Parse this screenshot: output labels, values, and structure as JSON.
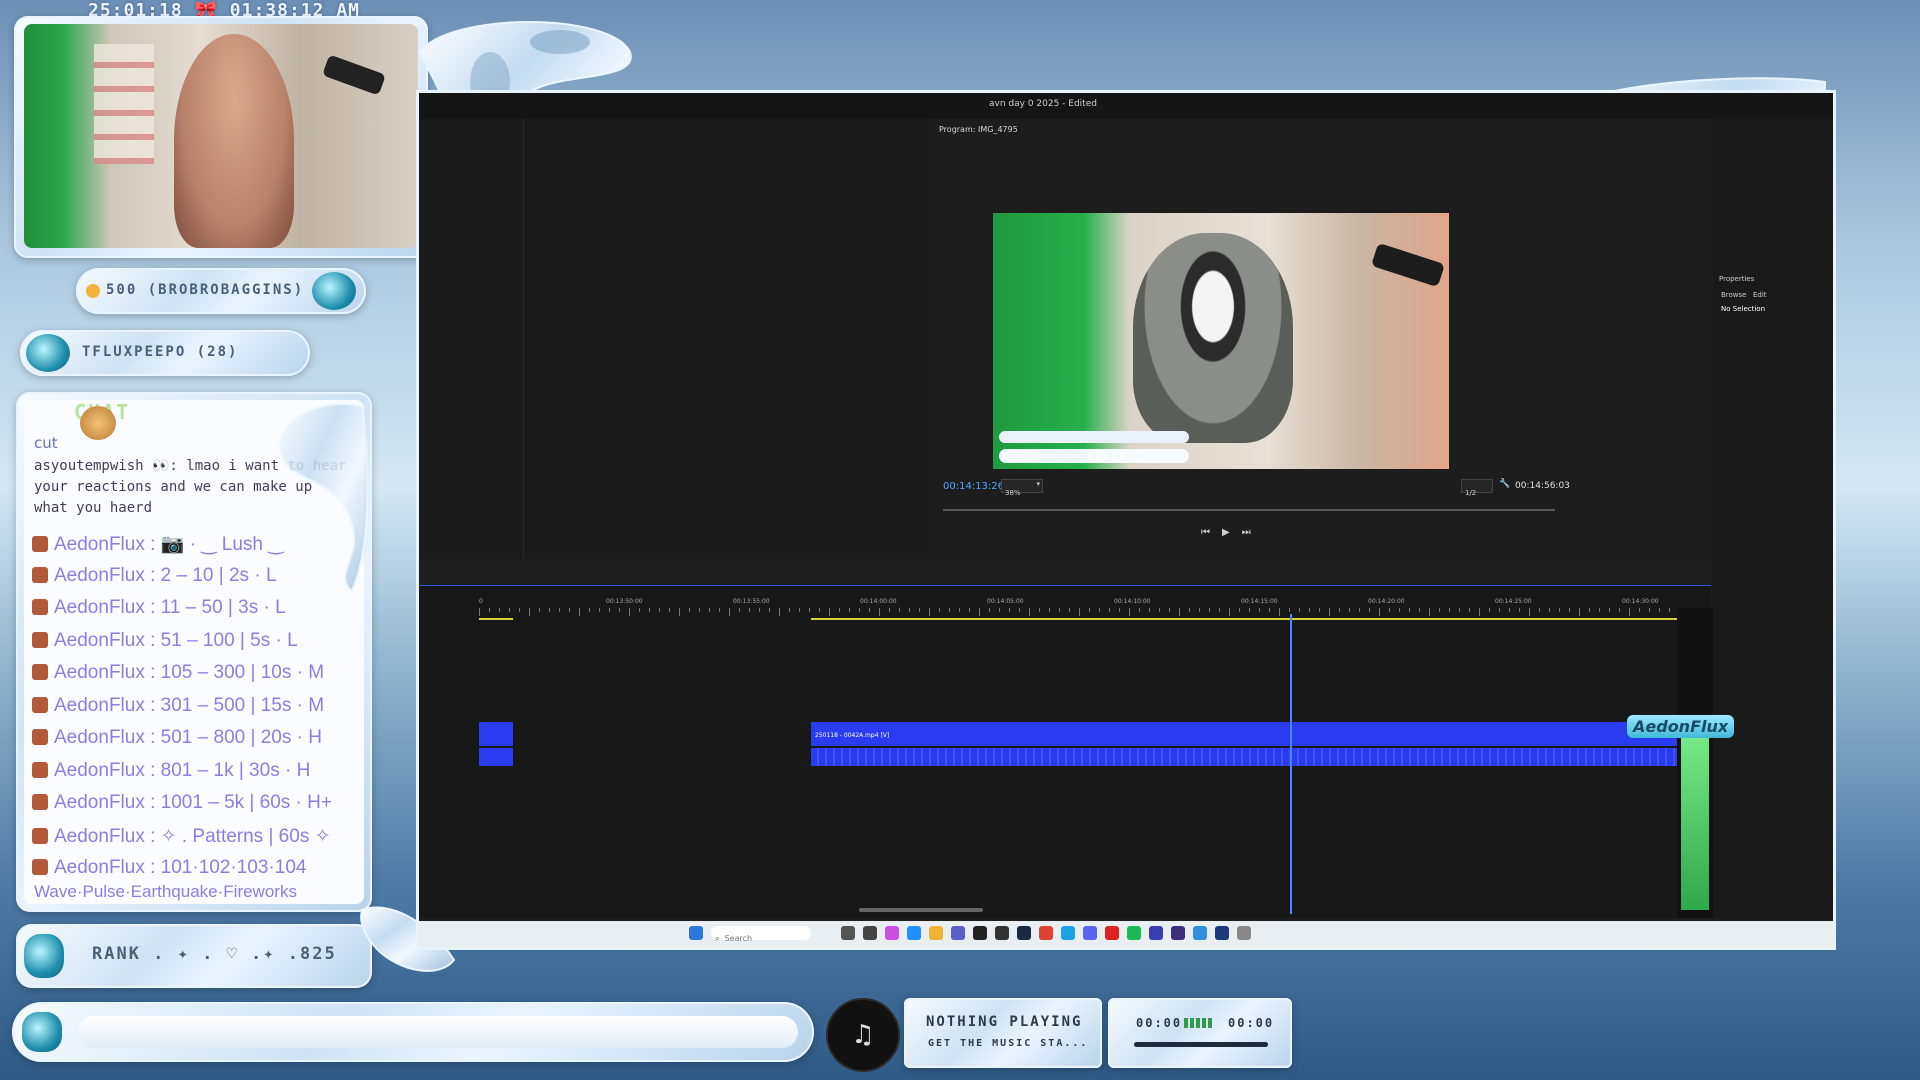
{
  "stream": {
    "datetime": "25:01:18 🎀 01:38:12 AM",
    "alerts": [
      {
        "text": "500 (BROBROBAGGINS)"
      },
      {
        "text": "TFLUXPEEPO (28)"
      }
    ],
    "chat_header": "CHAT",
    "chat_lines": [
      {
        "text": "cut",
        "color": "#7a70c8"
      },
      {
        "text": "asyoutempwish 👀: lmao i want to hear your reactions and we can make up what you haerd",
        "color": "#4a4a6a"
      }
    ],
    "commands": [
      "AedonFlux : 📷 · ‿ Lush ‿",
      "AedonFlux : 2 – 10 | 2s · L",
      "AedonFlux : 11 – 50 | 3s · L",
      "AedonFlux : 51 – 100 | 5s · L",
      "AedonFlux : 105 – 300 | 10s · M",
      "AedonFlux : 301 – 500 | 15s · M",
      "AedonFlux : 501 – 800 | 20s · H",
      "AedonFlux : 801 – 1k | 30s · H",
      "AedonFlux : 1001 – 5k | 60s · H+",
      "AedonFlux : ✧ . Patterns | 60s ✧",
      "AedonFlux : 101·102·103·104"
    ],
    "command_tail": "Wave·Pulse·Earthquake·Fireworks",
    "rank_label": "RANK . ✦ . ♡ .✦ .825",
    "music": {
      "title": "NOTHING PLAYING",
      "subtitle": "GET THE MUSIC STA...",
      "time_start": "00:00",
      "time_end": "00:00"
    },
    "logo_text": "AedonFlux"
  },
  "editor": {
    "window_title": "avn day 0 2025 - Edited",
    "program_tab": "Program: IMG_4795",
    "timecode_current": "00:14:13:26",
    "zoom": "38%",
    "quality": "1/2",
    "timecode_duration": "00:14:56:03",
    "ruler_labels": [
      "0",
      "00:13:50:00",
      "00:13:55:00",
      "00:14:00:00",
      "00:14:05:00",
      "00:14:10:00",
      "00:14:15:00",
      "00:14:20:00",
      "00:14:25:00",
      "00:14:30:00"
    ],
    "clip_label": "250118 - 0042A.mp4 [V]",
    "properties": {
      "title": "Properties",
      "tab_browse": "Browse",
      "tab_edit": "Edit",
      "status": "No Selection"
    },
    "playhead_pct": 0.67
  },
  "taskbar": {
    "search_placeholder": "Search",
    "icons": [
      "windows-icon",
      "widgets-icon",
      "taskview-icon",
      "copilot-icon",
      "store-icon",
      "files-icon",
      "teams-icon",
      "obs-icon",
      "notion-icon",
      "steam-icon",
      "chrome-icon",
      "skype-icon",
      "discord-icon",
      "opera-icon",
      "spotify-icon",
      "premiere-icon",
      "aftereffects-icon",
      "remote-icon",
      "ps-icon",
      "calc-icon"
    ]
  },
  "colors": {
    "accent": "#2a3cf0",
    "chat_name": "#8e7de0",
    "timecode": "#4fa3ff",
    "meter": "#3ed05a"
  }
}
